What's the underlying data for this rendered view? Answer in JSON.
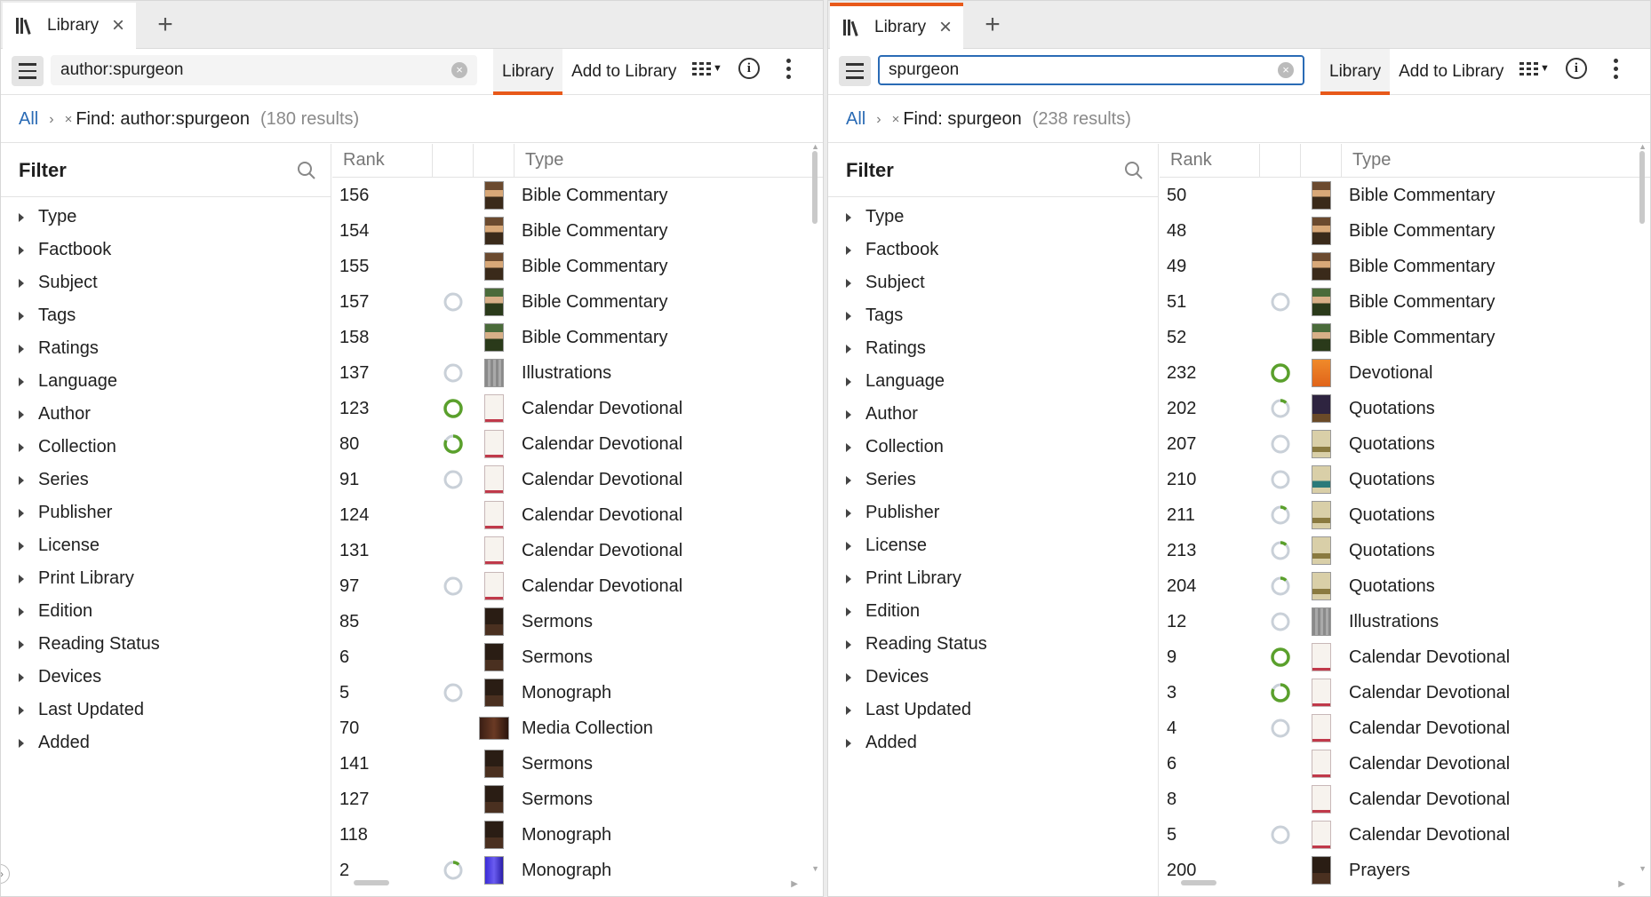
{
  "panes": [
    {
      "tab": {
        "label": "Library",
        "close_label": "×"
      },
      "new_tab_label": "+",
      "search": {
        "value": "author:spurgeon",
        "clear_label": "×"
      },
      "toolbar": {
        "library_label": "Library",
        "add_label": "Add to Library"
      },
      "breadcrumb": {
        "all_label": "All",
        "separator": "›",
        "remove_label": "×",
        "find_label": "Find: author:spurgeon",
        "count_label": "(180 results)"
      },
      "filter": {
        "title": "Filter",
        "facets": [
          "Type",
          "Factbook",
          "Subject",
          "Tags",
          "Ratings",
          "Language",
          "Author",
          "Collection",
          "Series",
          "Publisher",
          "License",
          "Print Library",
          "Edition",
          "Reading Status",
          "Devices",
          "Last Updated",
          "Added"
        ]
      },
      "columns": {
        "rank": "Rank",
        "type": "Type"
      },
      "rows": [
        {
          "rank": "156",
          "type": "Bible Commentary",
          "status": "none",
          "cover": "portrait"
        },
        {
          "rank": "154",
          "type": "Bible Commentary",
          "status": "none",
          "cover": "portrait"
        },
        {
          "rank": "155",
          "type": "Bible Commentary",
          "status": "none",
          "cover": "portrait"
        },
        {
          "rank": "157",
          "type": "Bible Commentary",
          "status": "empty",
          "cover": "portrait-green"
        },
        {
          "rank": "158",
          "type": "Bible Commentary",
          "status": "none",
          "cover": "portrait-green"
        },
        {
          "rank": "137",
          "type": "Illustrations",
          "status": "empty",
          "cover": "gray"
        },
        {
          "rank": "123",
          "type": "Calendar Devotional",
          "status": "full",
          "cover": "365"
        },
        {
          "rank": "80",
          "type": "Calendar Devotional",
          "status": "mostly",
          "cover": "365"
        },
        {
          "rank": "91",
          "type": "Calendar Devotional",
          "status": "empty",
          "cover": "365"
        },
        {
          "rank": "124",
          "type": "Calendar Devotional",
          "status": "none",
          "cover": "365"
        },
        {
          "rank": "131",
          "type": "Calendar Devotional",
          "status": "none",
          "cover": "365"
        },
        {
          "rank": "97",
          "type": "Calendar Devotional",
          "status": "empty",
          "cover": "365"
        },
        {
          "rank": "85",
          "type": "Sermons",
          "status": "none",
          "cover": "dark"
        },
        {
          "rank": "6",
          "type": "Sermons",
          "status": "none",
          "cover": "dark"
        },
        {
          "rank": "5",
          "type": "Monograph",
          "status": "empty",
          "cover": "dark"
        },
        {
          "rank": "70",
          "type": "Media Collection",
          "status": "none",
          "cover": "media"
        },
        {
          "rank": "141",
          "type": "Sermons",
          "status": "none",
          "cover": "dark"
        },
        {
          "rank": "127",
          "type": "Sermons",
          "status": "none",
          "cover": "dark"
        },
        {
          "rank": "118",
          "type": "Monograph",
          "status": "none",
          "cover": "dark"
        },
        {
          "rank": "2",
          "type": "Monograph",
          "status": "partial",
          "cover": "blue"
        }
      ]
    },
    {
      "tab": {
        "label": "Library",
        "close_label": "×"
      },
      "new_tab_label": "+",
      "search": {
        "value": "spurgeon",
        "clear_label": "×"
      },
      "toolbar": {
        "library_label": "Library",
        "add_label": "Add to Library"
      },
      "breadcrumb": {
        "all_label": "All",
        "separator": "›",
        "remove_label": "×",
        "find_label": "Find: spurgeon",
        "count_label": "(238 results)"
      },
      "filter": {
        "title": "Filter",
        "facets": [
          "Type",
          "Factbook",
          "Subject",
          "Tags",
          "Ratings",
          "Language",
          "Author",
          "Collection",
          "Series",
          "Publisher",
          "License",
          "Print Library",
          "Edition",
          "Reading Status",
          "Devices",
          "Last Updated",
          "Added"
        ]
      },
      "columns": {
        "rank": "Rank",
        "type": "Type"
      },
      "rows": [
        {
          "rank": "50",
          "type": "Bible Commentary",
          "status": "none",
          "cover": "portrait"
        },
        {
          "rank": "48",
          "type": "Bible Commentary",
          "status": "none",
          "cover": "portrait"
        },
        {
          "rank": "49",
          "type": "Bible Commentary",
          "status": "none",
          "cover": "portrait"
        },
        {
          "rank": "51",
          "type": "Bible Commentary",
          "status": "empty",
          "cover": "portrait-green"
        },
        {
          "rank": "52",
          "type": "Bible Commentary",
          "status": "none",
          "cover": "portrait-green"
        },
        {
          "rank": "232",
          "type": "Devotional",
          "status": "full",
          "cover": "orange"
        },
        {
          "rank": "202",
          "type": "Quotations",
          "status": "partial",
          "cover": "purple"
        },
        {
          "rank": "207",
          "type": "Quotations",
          "status": "empty",
          "cover": "quote"
        },
        {
          "rank": "210",
          "type": "Quotations",
          "status": "empty",
          "cover": "quote-teal"
        },
        {
          "rank": "211",
          "type": "Quotations",
          "status": "partial",
          "cover": "quote"
        },
        {
          "rank": "213",
          "type": "Quotations",
          "status": "partial",
          "cover": "quote"
        },
        {
          "rank": "204",
          "type": "Quotations",
          "status": "partial",
          "cover": "quote"
        },
        {
          "rank": "12",
          "type": "Illustrations",
          "status": "empty",
          "cover": "gray"
        },
        {
          "rank": "9",
          "type": "Calendar Devotional",
          "status": "full",
          "cover": "365"
        },
        {
          "rank": "3",
          "type": "Calendar Devotional",
          "status": "mostly",
          "cover": "365"
        },
        {
          "rank": "4",
          "type": "Calendar Devotional",
          "status": "empty",
          "cover": "365"
        },
        {
          "rank": "6",
          "type": "Calendar Devotional",
          "status": "none",
          "cover": "365"
        },
        {
          "rank": "8",
          "type": "Calendar Devotional",
          "status": "none",
          "cover": "365"
        },
        {
          "rank": "5",
          "type": "Calendar Devotional",
          "status": "empty",
          "cover": "365"
        },
        {
          "rank": "200",
          "type": "Prayers",
          "status": "none",
          "cover": "dark"
        }
      ]
    }
  ],
  "colors": {
    "accent": "#e8591a",
    "link": "#2a6bb5",
    "progress": "#5aa02c",
    "ring": "#c9d0d8"
  },
  "icons": [
    "library-icon",
    "close-icon",
    "plus-icon",
    "hamburger-icon",
    "clear-icon",
    "grid-view-icon",
    "info-icon",
    "more-icon",
    "search-icon",
    "chevron-right-icon",
    "expand-triangle-icon"
  ]
}
